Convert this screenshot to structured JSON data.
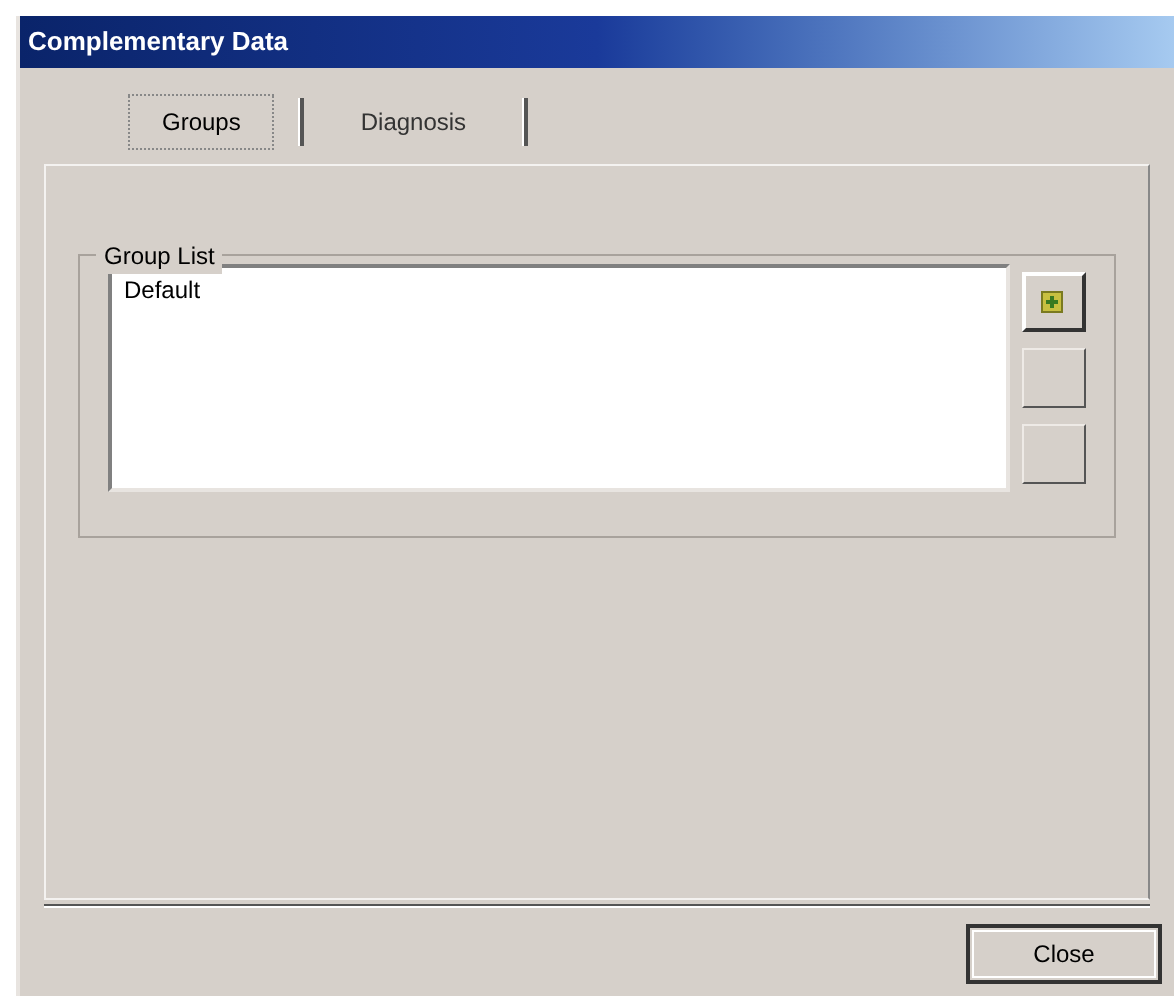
{
  "window": {
    "title": "Complementary Data"
  },
  "tabs": [
    {
      "label": "Groups",
      "selected": true
    },
    {
      "label": "Diagnosis",
      "selected": false
    }
  ],
  "group_list": {
    "label": "Group List",
    "items": [
      {
        "label": "Default",
        "selected": false
      }
    ],
    "buttons": [
      {
        "kind": "add",
        "disabled": false
      },
      {
        "kind": "edit",
        "disabled": true
      },
      {
        "kind": "remove",
        "disabled": true
      }
    ]
  },
  "footer": {
    "close_button": "Close"
  }
}
